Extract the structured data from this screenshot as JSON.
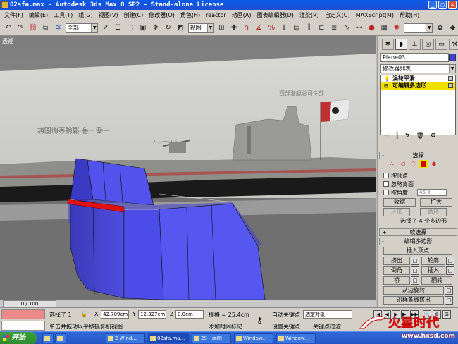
{
  "window": {
    "title": "02sfa.max - Autodesk 3ds Max 8 SP2 - Stand-alone License"
  },
  "menu": [
    "文件(F)",
    "编辑(E)",
    "工具(T)",
    "组(G)",
    "视图(V)",
    "创建(C)",
    "修改器(O)",
    "角色(H)",
    "reactor",
    "动画(A)",
    "图表编辑器(D)",
    "渲染(R)",
    "自定义(U)",
    "MAXScript(M)",
    "帮助(H)"
  ],
  "toolbar": {
    "selection_filter": "全部",
    "ref_coord": "视图"
  },
  "viewport": {
    "label": "透视",
    "plate_text_1": "西部潜艇总司令部",
    "plate_text_2": "一卷三号·潜艇全船图解",
    "plate_text_3": "ㅅㅅ·一·ㅅㅅ"
  },
  "command_panel": {
    "object_name": "Plane03",
    "object_color": "#4040d8",
    "modifier_list": "修改器列表",
    "stack": [
      {
        "label": "涡轮平滑",
        "selected": false
      },
      {
        "label": "可编辑多边形",
        "selected": true
      }
    ],
    "selection_rollout": "选择",
    "by_vertex": "按顶点",
    "ignore_backfacing": "忽略背面",
    "by_angle": "按角度:",
    "angle_value": "45.0",
    "shrink": "收缩",
    "grow": "扩大",
    "ring": "环形",
    "loop": "循环",
    "selected_info": "选择了 4 个多边形",
    "soft_selection": "软选择",
    "edit_polygons": "编辑多边形",
    "insert_vertex": "插入顶点",
    "extrude": "挤出",
    "outline": "轮廓",
    "bevel": "倒角",
    "inset": "插入",
    "bridge": "桥",
    "flip": "翻转",
    "hinge_from_edge": "从边旋转",
    "extrude_along_spline": "沿样条线挤出"
  },
  "timebar": {
    "slider": "0 / 100"
  },
  "status": {
    "selected": "选择了 1",
    "x_label": "X",
    "x_value": "42.709cm",
    "y_label": "Y",
    "y_value": "12.327cm",
    "z_label": "Z",
    "z_value": "0.0cm",
    "grid": "栅格 = 25.4cm",
    "prompt": "单击并拖动以平移摄影机视图",
    "add_time_tag": "添加时间标记",
    "auto_key": "自动关键点",
    "set_key": "设置关键点",
    "selected_object": "选定对象",
    "key_filters": "关键点过滤"
  },
  "taskbar": {
    "start": "开始",
    "tasks": [
      "02sfa.ma...",
      "2 Wind...",
      "",
      "29 - 画图",
      "Window...",
      "Window...",
      ""
    ]
  },
  "watermark": {
    "logo": "火星时代",
    "url": "www.hxsd.com"
  }
}
